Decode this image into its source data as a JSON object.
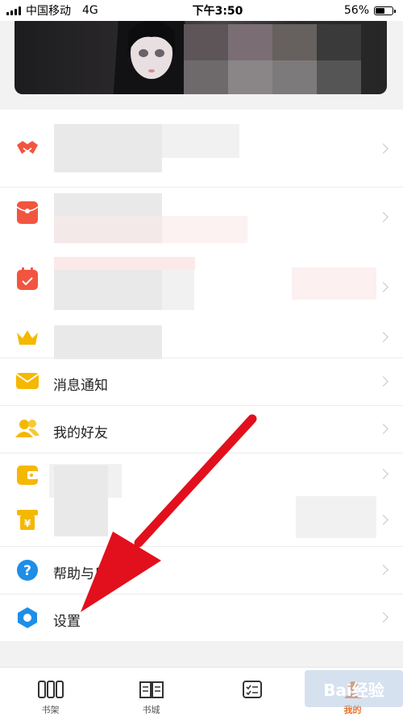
{
  "status_bar": {
    "carrier": "中国移动",
    "network": "4G",
    "time": "下午3:50",
    "battery": "56%",
    "battery_level": 0.56
  },
  "menu": {
    "items": [
      {
        "label": "",
        "icon": "handshake-icon",
        "color": "#f2553f"
      },
      {
        "label": "",
        "icon": "red-envelope-icon",
        "color": "#f2553f"
      },
      {
        "label": "",
        "icon": "calendar-check-icon",
        "color": "#f2553f"
      },
      {
        "label": "",
        "icon": "crown-icon",
        "color": "#f5b800"
      },
      {
        "label": "消息通知",
        "icon": "mail-icon",
        "color": "#f5b800"
      },
      {
        "label": "我的好友",
        "icon": "friends-icon",
        "color": "#f5b800"
      },
      {
        "label": "",
        "icon": "wallet-icon",
        "color": "#f5b800"
      },
      {
        "label": "",
        "icon": "atm-icon",
        "color": "#f5b800"
      },
      {
        "label": "帮助与反",
        "icon": "help-icon",
        "color": "#1e8ee8"
      },
      {
        "label": "设置",
        "icon": "settings-icon",
        "color": "#1e8ee8"
      }
    ]
  },
  "bottom_nav": {
    "tabs": [
      {
        "label": "书架",
        "icon": "bookshelf-icon"
      },
      {
        "label": "书城",
        "icon": "book-store-icon"
      },
      {
        "label": "",
        "icon": "task-list-icon"
      },
      {
        "label": "我的",
        "icon": "profile-icon"
      }
    ],
    "active_index": 3
  },
  "watermark": {
    "text": "Bai经验"
  },
  "colors": {
    "accent": "#e8712b",
    "arrow": "#e2101c"
  }
}
